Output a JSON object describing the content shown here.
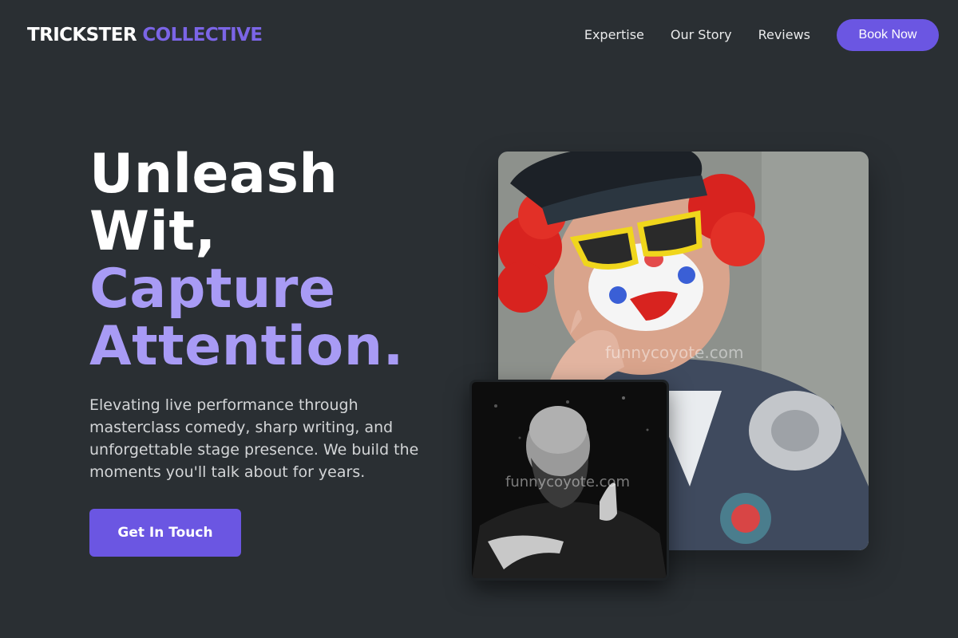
{
  "brand": {
    "name_part1": "TRICKSTER",
    "name_part2": "COLLECTIVE"
  },
  "nav": {
    "links": [
      "Expertise",
      "Our Story",
      "Reviews"
    ],
    "cta_label": "Book Now"
  },
  "hero": {
    "headline_lines": [
      "Unleash",
      "Wit,"
    ],
    "headline_accent_lines": [
      "Capture",
      "Attention."
    ],
    "description": "Elevating live performance through masterclass comedy, sharp writing, and unforgettable stage presence. We build the moments you'll talk about for years.",
    "cta_label": "Get In Touch"
  },
  "images": {
    "main_watermark": "funnycoyote.com",
    "small_watermark": "funnycoyote.com"
  },
  "colors": {
    "background": "#2a2f33",
    "accent": "#6b56e2",
    "accent_light": "#a89bf5"
  }
}
